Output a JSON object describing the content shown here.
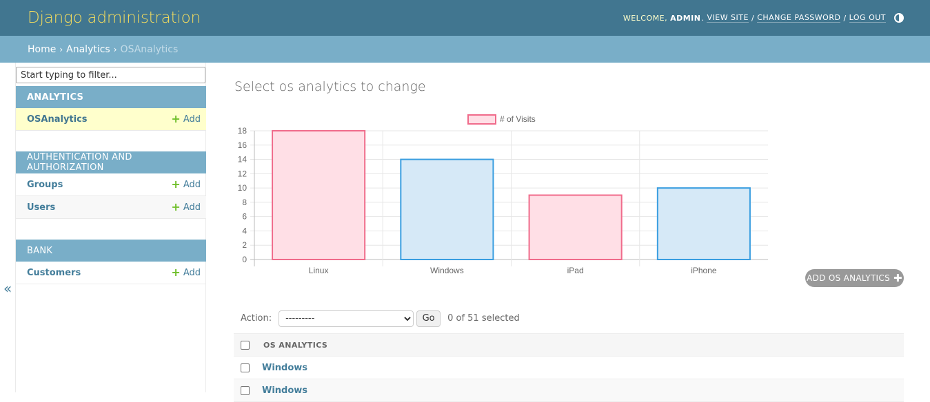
{
  "header": {
    "branding": "Django administration",
    "welcome": "WELCOME,",
    "username": "ADMIN",
    "view_site": "VIEW SITE",
    "change_password": "CHANGE PASSWORD",
    "log_out": "LOG OUT"
  },
  "breadcrumbs": {
    "home": "Home",
    "app": "Analytics",
    "current": "OSAnalytics",
    "separator": "›"
  },
  "sidebar": {
    "filter_placeholder": "Start typing to filter...",
    "collapse_icon": "«",
    "modules": [
      {
        "caption": "ANALYTICS",
        "models": [
          {
            "name": "OSAnalytics",
            "add": "Add"
          }
        ]
      },
      {
        "caption": "AUTHENTICATION AND AUTHORIZATION",
        "models": [
          {
            "name": "Groups",
            "add": "Add"
          },
          {
            "name": "Users",
            "add": "Add"
          }
        ]
      },
      {
        "caption": "BANK",
        "models": [
          {
            "name": "Customers",
            "add": "Add"
          }
        ]
      }
    ]
  },
  "content": {
    "title": "Select os analytics to change",
    "add_button": "ADD OS ANALYTICS"
  },
  "chart_data": {
    "type": "bar",
    "categories": [
      "Linux",
      "Windows",
      "iPad",
      "iPhone"
    ],
    "values": [
      18,
      14,
      9,
      10
    ],
    "series": [
      {
        "name": "# of Visits",
        "values": [
          18,
          14,
          9,
          10
        ]
      }
    ],
    "legend": "top-center",
    "ylim": [
      0,
      18
    ],
    "yticks": [
      0,
      2,
      4,
      6,
      8,
      10,
      12,
      14,
      16,
      18
    ],
    "grid": true,
    "colors": {
      "pink_fill": "#ffdfe6",
      "pink_stroke": "#f06b8b",
      "blue_fill": "#d6e9f7",
      "blue_stroke": "#3a9ee0"
    }
  },
  "actions": {
    "label": "Action:",
    "selected_option": "---------",
    "go": "Go",
    "counter": "0 of 51 selected"
  },
  "table": {
    "header": "OS ANALYTICS",
    "rows": [
      "Windows",
      "Windows"
    ]
  },
  "colors": {
    "header_bg": "#417690",
    "breadcrumb_bg": "#79aec8",
    "branding": "#f5dd5d",
    "link": "#447e9b",
    "add_plus": "#70bf2b"
  }
}
